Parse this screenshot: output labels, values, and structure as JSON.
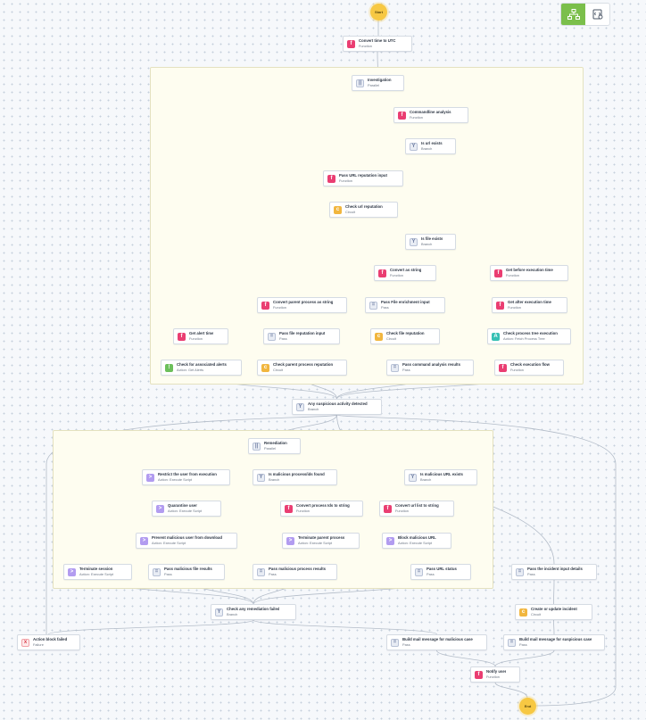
{
  "toolbar": {
    "workflow_view": "workflow-icon",
    "code_view": "code-icon",
    "active_color": "#7bbf4b"
  },
  "terminals": {
    "start": "Start",
    "end": "End"
  },
  "nodes": {
    "n_convert_utc": {
      "title": "Convert time to UTC",
      "type": "Function"
    },
    "n_investigation": {
      "title": "Investigation",
      "type": "Parallel"
    },
    "n_cmdline": {
      "title": "Commandline analysis",
      "type": "Function"
    },
    "n_is_url": {
      "title": "Is url exists",
      "type": "Branch"
    },
    "n_pass_url_rep": {
      "title": "Pass URL reputation input",
      "type": "Function"
    },
    "n_check_url_rep": {
      "title": "Check url reputation",
      "type": "Circuit"
    },
    "n_is_file": {
      "title": "Is file exists",
      "type": "Branch"
    },
    "n_conv_str": {
      "title": "Convert as string",
      "type": "Function"
    },
    "n_get_before": {
      "title": "Get before execution time",
      "type": "Function"
    },
    "n_conv_parent": {
      "title": "Convert parent process as string",
      "type": "Function"
    },
    "n_pass_file_enrich": {
      "title": "Pass File enrichment input",
      "type": "Pass"
    },
    "n_get_after": {
      "title": "Get after execution time",
      "type": "Function"
    },
    "n_get_alert_time": {
      "title": "Get alert time",
      "type": "Function"
    },
    "n_pass_file_rep": {
      "title": "Pass file reputation input",
      "type": "Pass"
    },
    "n_check_file_rep": {
      "title": "Check file reputation",
      "type": "Circuit"
    },
    "n_check_proc_tree": {
      "title": "Check process tree execution",
      "type": "Action: Fetch Process Tree"
    },
    "n_check_alerts": {
      "title": "Check for associated alerts",
      "type": "Action: Get Alerts"
    },
    "n_check_parent_rep": {
      "title": "Check parent process reputation",
      "type": "Circuit"
    },
    "n_pass_cmd_results": {
      "title": "Pass command analysis results",
      "type": "Pass"
    },
    "n_check_exec_flow": {
      "title": "Check execution flow",
      "type": "Function"
    },
    "n_any_suspicious": {
      "title": "Any suspicious activity detected",
      "type": "Branch"
    },
    "n_remediation": {
      "title": "Remediation",
      "type": "Parallel"
    },
    "n_restrict_user": {
      "title": "Restrict the user from execution",
      "type": "Action: Execute Script"
    },
    "n_is_mal_proc": {
      "title": "Is malicious process/ids found",
      "type": "Branch"
    },
    "n_is_mal_url": {
      "title": "Is malicious URL exists",
      "type": "Branch"
    },
    "n_quarantine": {
      "title": "Quarantine user",
      "type": "Action: Execute Script"
    },
    "n_conv_proc_ids": {
      "title": "Convert process Ids to string",
      "type": "Function"
    },
    "n_conv_url_list": {
      "title": "Convert url list to string",
      "type": "Function"
    },
    "n_prevent_download": {
      "title": "Prevent malicious user from download",
      "type": "Action: Execute Script"
    },
    "n_terminate_parent": {
      "title": "Terminate parent process",
      "type": "Action: Execute Script"
    },
    "n_block_url": {
      "title": "Block malicious URL",
      "type": "Action: Execute Script"
    },
    "n_terminate_session": {
      "title": "Terminate session",
      "type": "Action: Execute Script"
    },
    "n_pass_mal_file": {
      "title": "Pass malicious file results",
      "type": "Pass"
    },
    "n_pass_mal_proc": {
      "title": "Pass malicious process results",
      "type": "Pass"
    },
    "n_pass_url_status": {
      "title": "Pass URL status",
      "type": "Pass"
    },
    "n_pass_incident": {
      "title": "Pass the incident input details",
      "type": "Pass"
    },
    "n_check_remed_failed": {
      "title": "Check any remediation failed",
      "type": "Branch"
    },
    "n_create_incident": {
      "title": "Create or update incident",
      "type": "Circuit"
    },
    "n_action_block_failed": {
      "title": "Action block failed",
      "type": "Failure"
    },
    "n_build_mail_mal": {
      "title": "Build mail message for malicious case",
      "type": "Pass"
    },
    "n_build_mail_susp": {
      "title": "Build mail message for suspicious case",
      "type": "Pass"
    },
    "n_notify_user": {
      "title": "Notify user",
      "type": "Function"
    }
  }
}
